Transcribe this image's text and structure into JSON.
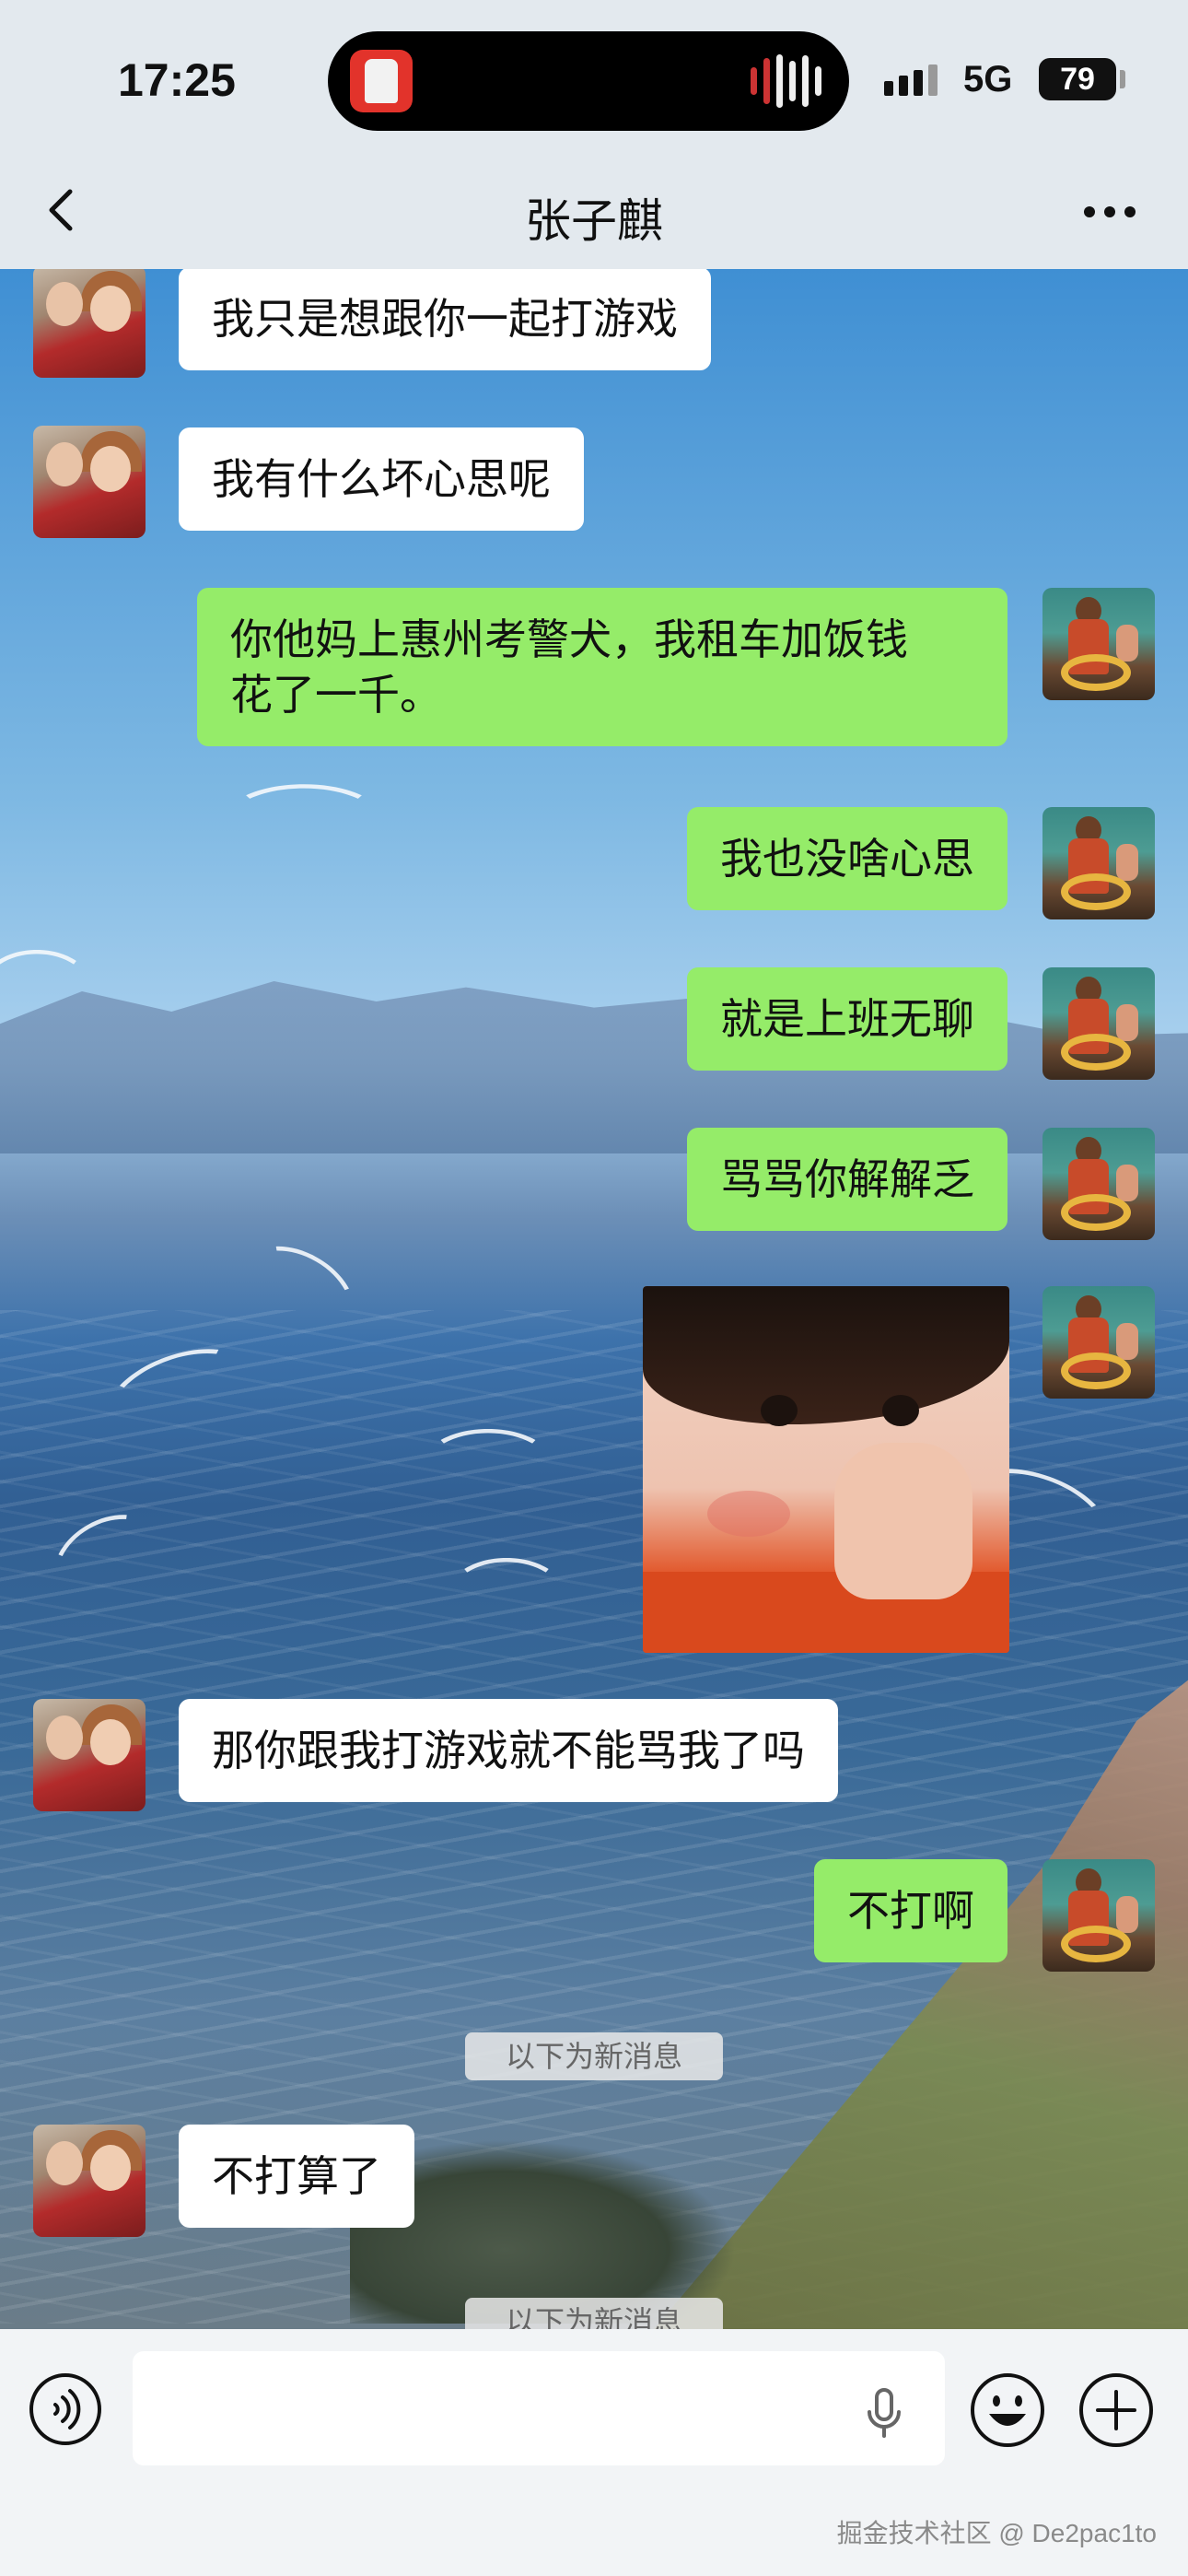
{
  "status_bar": {
    "time": "17:25",
    "network": "5G",
    "battery": "79"
  },
  "header": {
    "title": "张子麒"
  },
  "messages": [
    {
      "side": "in",
      "text": "我只是想跟你一起打游戏"
    },
    {
      "side": "in",
      "text": "我有什么坏心思呢"
    },
    {
      "side": "out",
      "text": "你他妈上惠州考警犬，我租车加饭钱\n花了一千。"
    },
    {
      "side": "out",
      "text": "我也没啥心思"
    },
    {
      "side": "out",
      "text": "就是上班无聊"
    },
    {
      "side": "out",
      "text": "骂骂你解解乏"
    },
    {
      "side": "out",
      "type": "sticker"
    },
    {
      "side": "in",
      "text": "那你跟我打游戏就不能骂我了吗"
    },
    {
      "side": "out",
      "text": "不打啊"
    },
    {
      "side": "in",
      "text": "不打算了"
    }
  ],
  "system_tips": {
    "new_messages": "以下为新消息",
    "new_messages_2": "以下为新消息"
  },
  "input_bar": {
    "placeholder": ""
  },
  "watermark": "掘金技术社区 @ De2pac1to",
  "colors": {
    "bubble_out": "#95ec69",
    "bubble_in": "#ffffff",
    "nav_bg": "#e3e9ee"
  },
  "icons": [
    "back-icon",
    "more-icon",
    "voice-icon",
    "mic-icon",
    "emoji-icon",
    "plus-icon"
  ]
}
